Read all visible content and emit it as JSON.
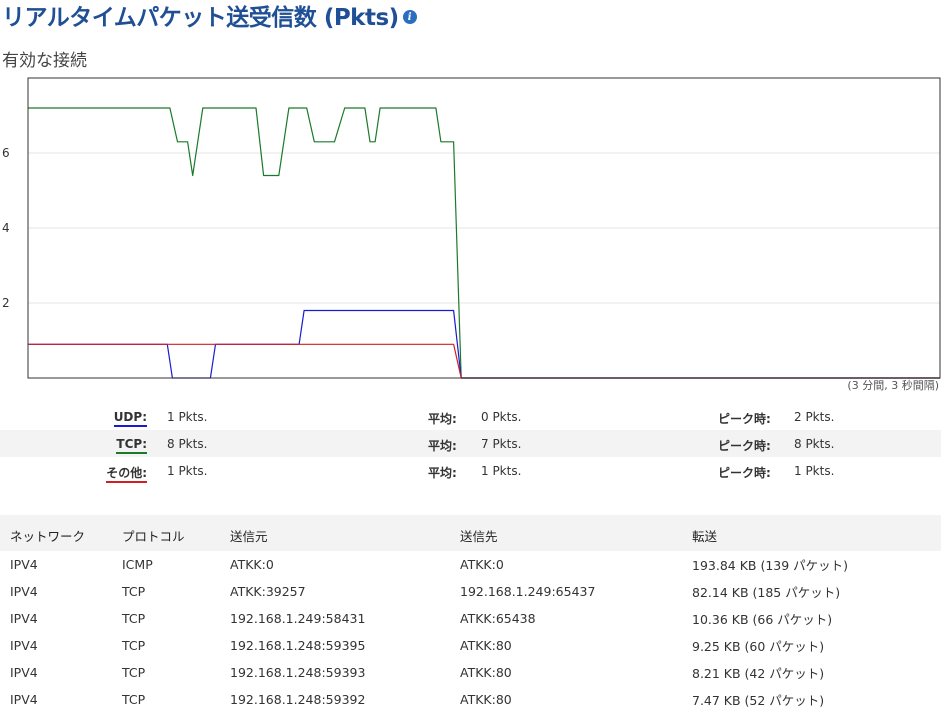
{
  "header": {
    "title": "リアルタイムパケット送受信数 (Pkts)",
    "info_icon": "info-icon"
  },
  "subtitle": "有効な接続",
  "chart_data": {
    "type": "line",
    "ylim": [
      0,
      8
    ],
    "yticks": [
      2,
      4,
      6
    ],
    "xrange": [
      0,
      180
    ],
    "grid": true,
    "duration_label": "(3 分間, 3 秒間隔)",
    "series": [
      {
        "name": "TCP",
        "color": "#1a7a2a",
        "points": [
          [
            0,
            7.2
          ],
          [
            28,
            7.2
          ],
          [
            29.5,
            6.3
          ],
          [
            31.5,
            6.3
          ],
          [
            32.5,
            5.4
          ],
          [
            34.5,
            7.2
          ],
          [
            45,
            7.2
          ],
          [
            46.5,
            5.4
          ],
          [
            49.5,
            5.4
          ],
          [
            51.5,
            7.2
          ],
          [
            55,
            7.2
          ],
          [
            56.5,
            6.3
          ],
          [
            60.5,
            6.3
          ],
          [
            62.5,
            7.2
          ],
          [
            66.5,
            7.2
          ],
          [
            67.5,
            6.3
          ],
          [
            68.5,
            6.3
          ],
          [
            69.5,
            7.2
          ],
          [
            80.5,
            7.2
          ],
          [
            81.5,
            6.3
          ],
          [
            84,
            6.3
          ],
          [
            85.5,
            0
          ],
          [
            180,
            0
          ]
        ]
      },
      {
        "name": "UDP",
        "color": "#1a1ad0",
        "points": [
          [
            0,
            0.9
          ],
          [
            27.5,
            0.9
          ],
          [
            28.5,
            0
          ],
          [
            36,
            0
          ],
          [
            37,
            0.9
          ],
          [
            53.5,
            0.9
          ],
          [
            54.5,
            1.8
          ],
          [
            84,
            1.8
          ],
          [
            85.5,
            0
          ],
          [
            180,
            0
          ]
        ]
      },
      {
        "name": "その他",
        "color": "#d02020",
        "points": [
          [
            0,
            0.9
          ],
          [
            84,
            0.9
          ],
          [
            85.5,
            0
          ],
          [
            180,
            0
          ]
        ]
      }
    ]
  },
  "stats": [
    {
      "name": "UDP:",
      "color": "#1a1ad0",
      "current": "1 Pkts.",
      "avg_label": "平均:",
      "avg": "0 Pkts.",
      "peak_label": "ピーク時:",
      "peak": "2 Pkts."
    },
    {
      "name": "TCP:",
      "color": "#1a7a2a",
      "current": "8 Pkts.",
      "avg_label": "平均:",
      "avg": "7 Pkts.",
      "peak_label": "ピーク時:",
      "peak": "8 Pkts."
    },
    {
      "name": "その他:",
      "color": "#d02020",
      "current": "1 Pkts.",
      "avg_label": "平均:",
      "avg": "1 Pkts.",
      "peak_label": "ピーク時:",
      "peak": "1 Pkts."
    }
  ],
  "connections": {
    "headers": [
      "ネットワーク",
      "プロトコル",
      "送信元",
      "送信先",
      "転送"
    ],
    "rows": [
      [
        "IPV4",
        "ICMP",
        "ATKK:0",
        "ATKK:0",
        "193.84 KB (139 パケット)"
      ],
      [
        "IPV4",
        "TCP",
        "ATKK:39257",
        "192.168.1.249:65437",
        "82.14 KB (185 パケット)"
      ],
      [
        "IPV4",
        "TCP",
        "192.168.1.249:58431",
        "ATKK:65438",
        "10.36 KB (66 パケット)"
      ],
      [
        "IPV4",
        "TCP",
        "192.168.1.248:59395",
        "ATKK:80",
        "9.25 KB (60 パケット)"
      ],
      [
        "IPV4",
        "TCP",
        "192.168.1.248:59393",
        "ATKK:80",
        "8.21 KB (42 パケット)"
      ],
      [
        "IPV4",
        "TCP",
        "192.168.1.248:59392",
        "ATKK:80",
        "7.47 KB (52 パケット)"
      ]
    ]
  }
}
